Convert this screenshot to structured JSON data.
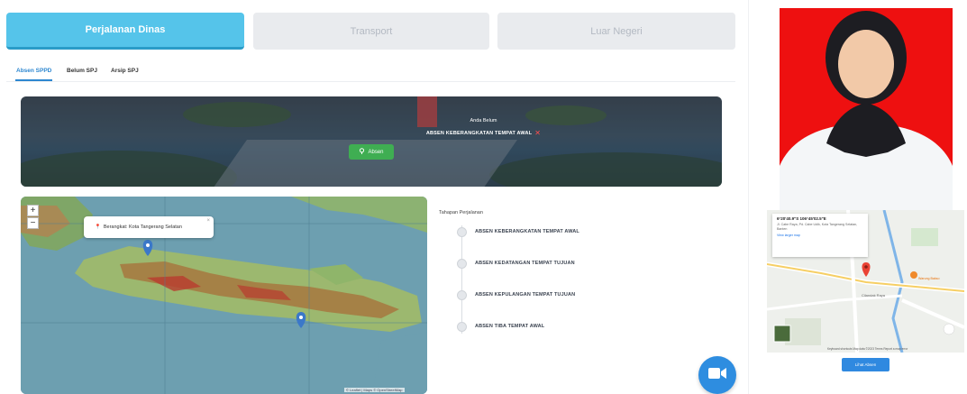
{
  "tabs": [
    {
      "label": "Perjalanan Dinas"
    },
    {
      "label": "Transport"
    },
    {
      "label": "Luar Negeri"
    }
  ],
  "subtabs": [
    {
      "label": "Absen SPPD"
    },
    {
      "label": "Belum SPJ"
    },
    {
      "label": "Arsip SPJ"
    }
  ],
  "banner": {
    "line1": "Anda Belum",
    "line2": "ABSEN KEBERANGKATAN TEMPAT AWAL",
    "button_label": "Absen"
  },
  "map": {
    "popup_text": "Berangkat: Kota Tangerang Selatan",
    "attribution": "© Leaflet | Maps © OpenStreetMap"
  },
  "timeline": {
    "title": "Tahapan Perjalanan",
    "steps": [
      {
        "label": "ABSEN KEBERANGKATAN TEMPAT AWAL"
      },
      {
        "label": "ABSEN KEDATANGAN TEMPAT TUJUAN"
      },
      {
        "label": "ABSEN KEPULANGAN TEMPAT TUJUAN"
      },
      {
        "label": "ABSEN TIBA TEMPAT AWAL"
      }
    ]
  },
  "location_map": {
    "coords": "6°20'40.9\"S 106°45'02.5\"E",
    "address": "Jl. Cabe Raya, Pd. Cabe Udik, Kota Tangerang Selatan, Banten",
    "link": "View larger map",
    "attribution": "Keyboard shortcuts  Map data ©2023  Terms  Report a map error",
    "road_label": "Cilandak Raya",
    "place_label": "Warung Bakso"
  },
  "lihat_button": "Lihat Absen",
  "colors": {
    "accent": "#55c4ea",
    "primary": "#2e8de0",
    "success": "#3fae52",
    "photo_bg": "#ee1010"
  }
}
